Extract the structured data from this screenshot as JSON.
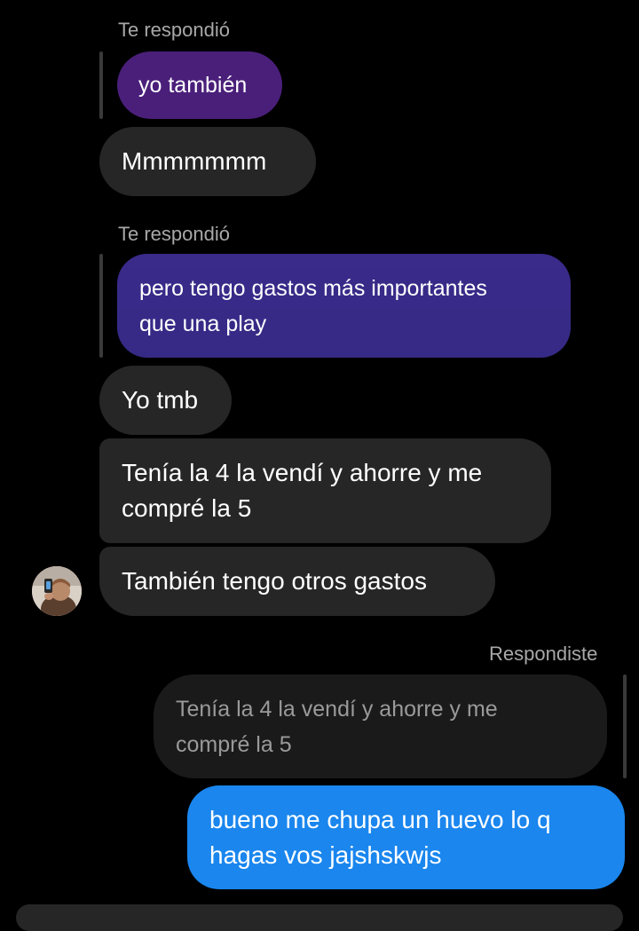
{
  "thread": {
    "reply1": {
      "label": "Te respondió",
      "quoted": "yo también",
      "message": "Mmmmmmm"
    },
    "reply2": {
      "label": "Te respondió",
      "quoted": "pero tengo gastos más importantes\nque una play"
    },
    "messages": [
      "Yo tmb",
      "Tenía la 4 la vendí y ahorre y me\ncompré la 5",
      "También tengo otros gastos"
    ],
    "my_reply": {
      "label": "Respondiste",
      "quoted": "Tenía la 4 la vendí y ahorre y me\ncompré la 5",
      "message": "bueno me chupa un huevo lo q\nhagas vos jajshskwjs"
    }
  },
  "colors": {
    "background": "#000000",
    "incoming_bubble": "#262626",
    "outgoing_bubble": "#1a86ee",
    "quoted_purple_top": "#4a1f7a",
    "quoted_purple_bottom": "#352a85",
    "reply_label": "#a8a8a8"
  },
  "avatar": {
    "icon": "contact-avatar"
  }
}
